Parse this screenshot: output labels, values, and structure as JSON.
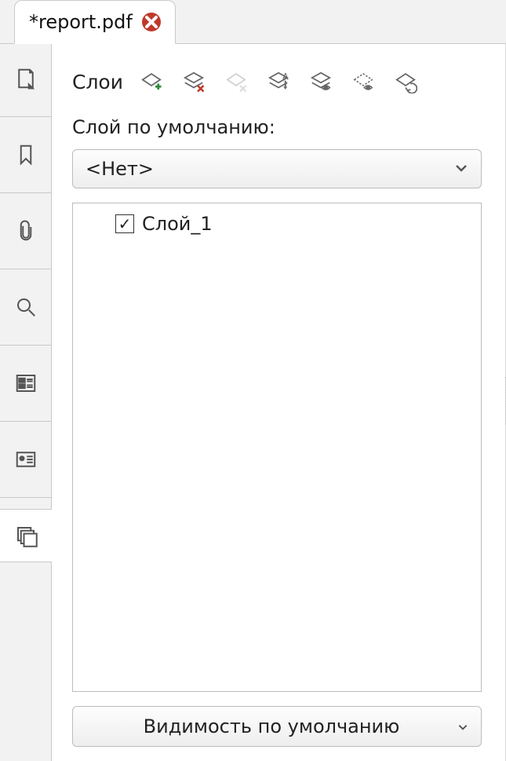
{
  "tab": {
    "title": "*report.pdf"
  },
  "panel": {
    "title": "Слои",
    "default_layer_label": "Слой по умолчанию:",
    "default_layer_value": "<Нет>",
    "visibility_label": "Видимость по умолчанию"
  },
  "layers": [
    {
      "name": "Слой_1",
      "checked": true
    }
  ],
  "icons": {
    "add_layer": "add-layer",
    "delete_layer": "delete-layer",
    "delete_layer_disabled": "delete-layer-disabled",
    "rename_layer": "rename-layer",
    "toggle_visible": "toggle-visible",
    "toggle_locked": "toggle-locked",
    "order_layer": "order-layer"
  }
}
